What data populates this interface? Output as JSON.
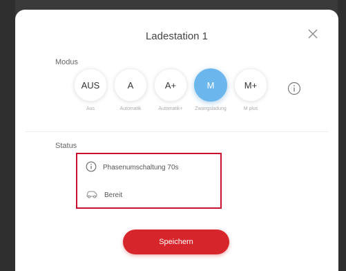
{
  "modal": {
    "title": "Ladestation 1",
    "mode_section_label": "Modus",
    "status_section_label": "Status",
    "modes": [
      {
        "label": "AUS",
        "caption": "Aus",
        "active": false
      },
      {
        "label": "A",
        "caption": "Automatik",
        "active": false
      },
      {
        "label": "A+",
        "caption": "Automatik+",
        "active": true
      },
      {
        "label": "M",
        "caption": "Zwangsladung",
        "active": true
      },
      {
        "label": "M+",
        "caption": "M plus",
        "active": false
      }
    ],
    "status": {
      "phase_text": "Phasenumschaltung 70s",
      "ready_text": "Bereit"
    },
    "save_label": "Speichern"
  },
  "colors": {
    "accent_blue": "#6bb6ec",
    "primary_red": "#d7262b",
    "highlight_border": "#c8102e"
  },
  "icons": {
    "close": "close-icon",
    "info": "info-icon",
    "charger": "car-charging-icon"
  }
}
